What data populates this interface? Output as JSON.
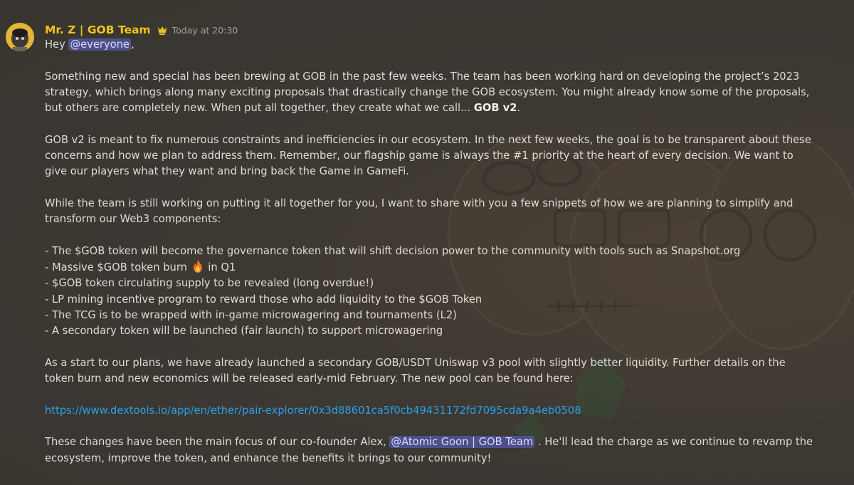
{
  "message": {
    "author": "Mr. Z | GOB Team",
    "role_icon": "crown-icon",
    "timestamp": "Today at 20:30",
    "greeting": "Hey",
    "greeting_mention": "@everyone",
    "greeting_end": ",",
    "p1_text": "Something new and special has been brewing at GOB in the past few weeks. The team has been working hard on developing the project’s 2023 strategy, which brings along many exciting proposals that drastically change the GOB ecosystem. You might already know some of the proposals, but others are completely new. When put all together, they create what we call...",
    "p1_bold": "GOB v2",
    "p1_end": ".",
    "p2_text": "GOB v2 is meant to fix numerous constraints and inefficiencies in our ecosystem. In the next few weeks, the goal is to be transparent about these concerns and how we plan to address them. Remember, our flagship game is always the #1 priority at the heart of every decision. We want to give our players what they want and bring back the Game in GameFi.",
    "p3_text": "While the team is still working on putting it all together for you, I want to share with you a few snippets of how we are planning to simplify and transform our Web3 components:",
    "bullets": [
      "- The $GOB token will become the governance token that will shift decision power to the community with tools such as Snapshot.org",
      "- Massive $GOB token burn",
      "- $GOB token circulating supply to be revealed (long overdue!)",
      "- LP mining incentive program to reward those who add liquidity to the $GOB Token",
      "- The TCG is to be wrapped with in-game microwagering and tournaments (L2)",
      "- A secondary token will be launched (fair launch) to support microwagering"
    ],
    "bullet2_emoji": "fire-emoji-icon",
    "bullet2_end": " in Q1",
    "p4_text": "As a start to our plans, we have already launched a secondary GOB/USDT Uniswap v3 pool with slightly better liquidity. Further details on the token burn and new economics will be released early-mid February.  The new pool can be found here:",
    "link": "https://www.dextools.io/app/en/ether/pair-explorer/0x3d88601ca5f0cb49431172fd7095cda9a4eb0508",
    "p5_start": "These changes have been the main focus of our co-founder Alex,",
    "p5_mention": "@Atomic Goon | GOB Team",
    "p5_end": ". He'll lead the charge as we continue to revamp the ecosystem, improve the token, and enhance the benefits it brings to our community!"
  },
  "colors": {
    "background": "#393632",
    "author": "#f2c21b",
    "text": "#dedcd6",
    "mention_bg": "#4f5089",
    "link": "#2aa0e8"
  }
}
